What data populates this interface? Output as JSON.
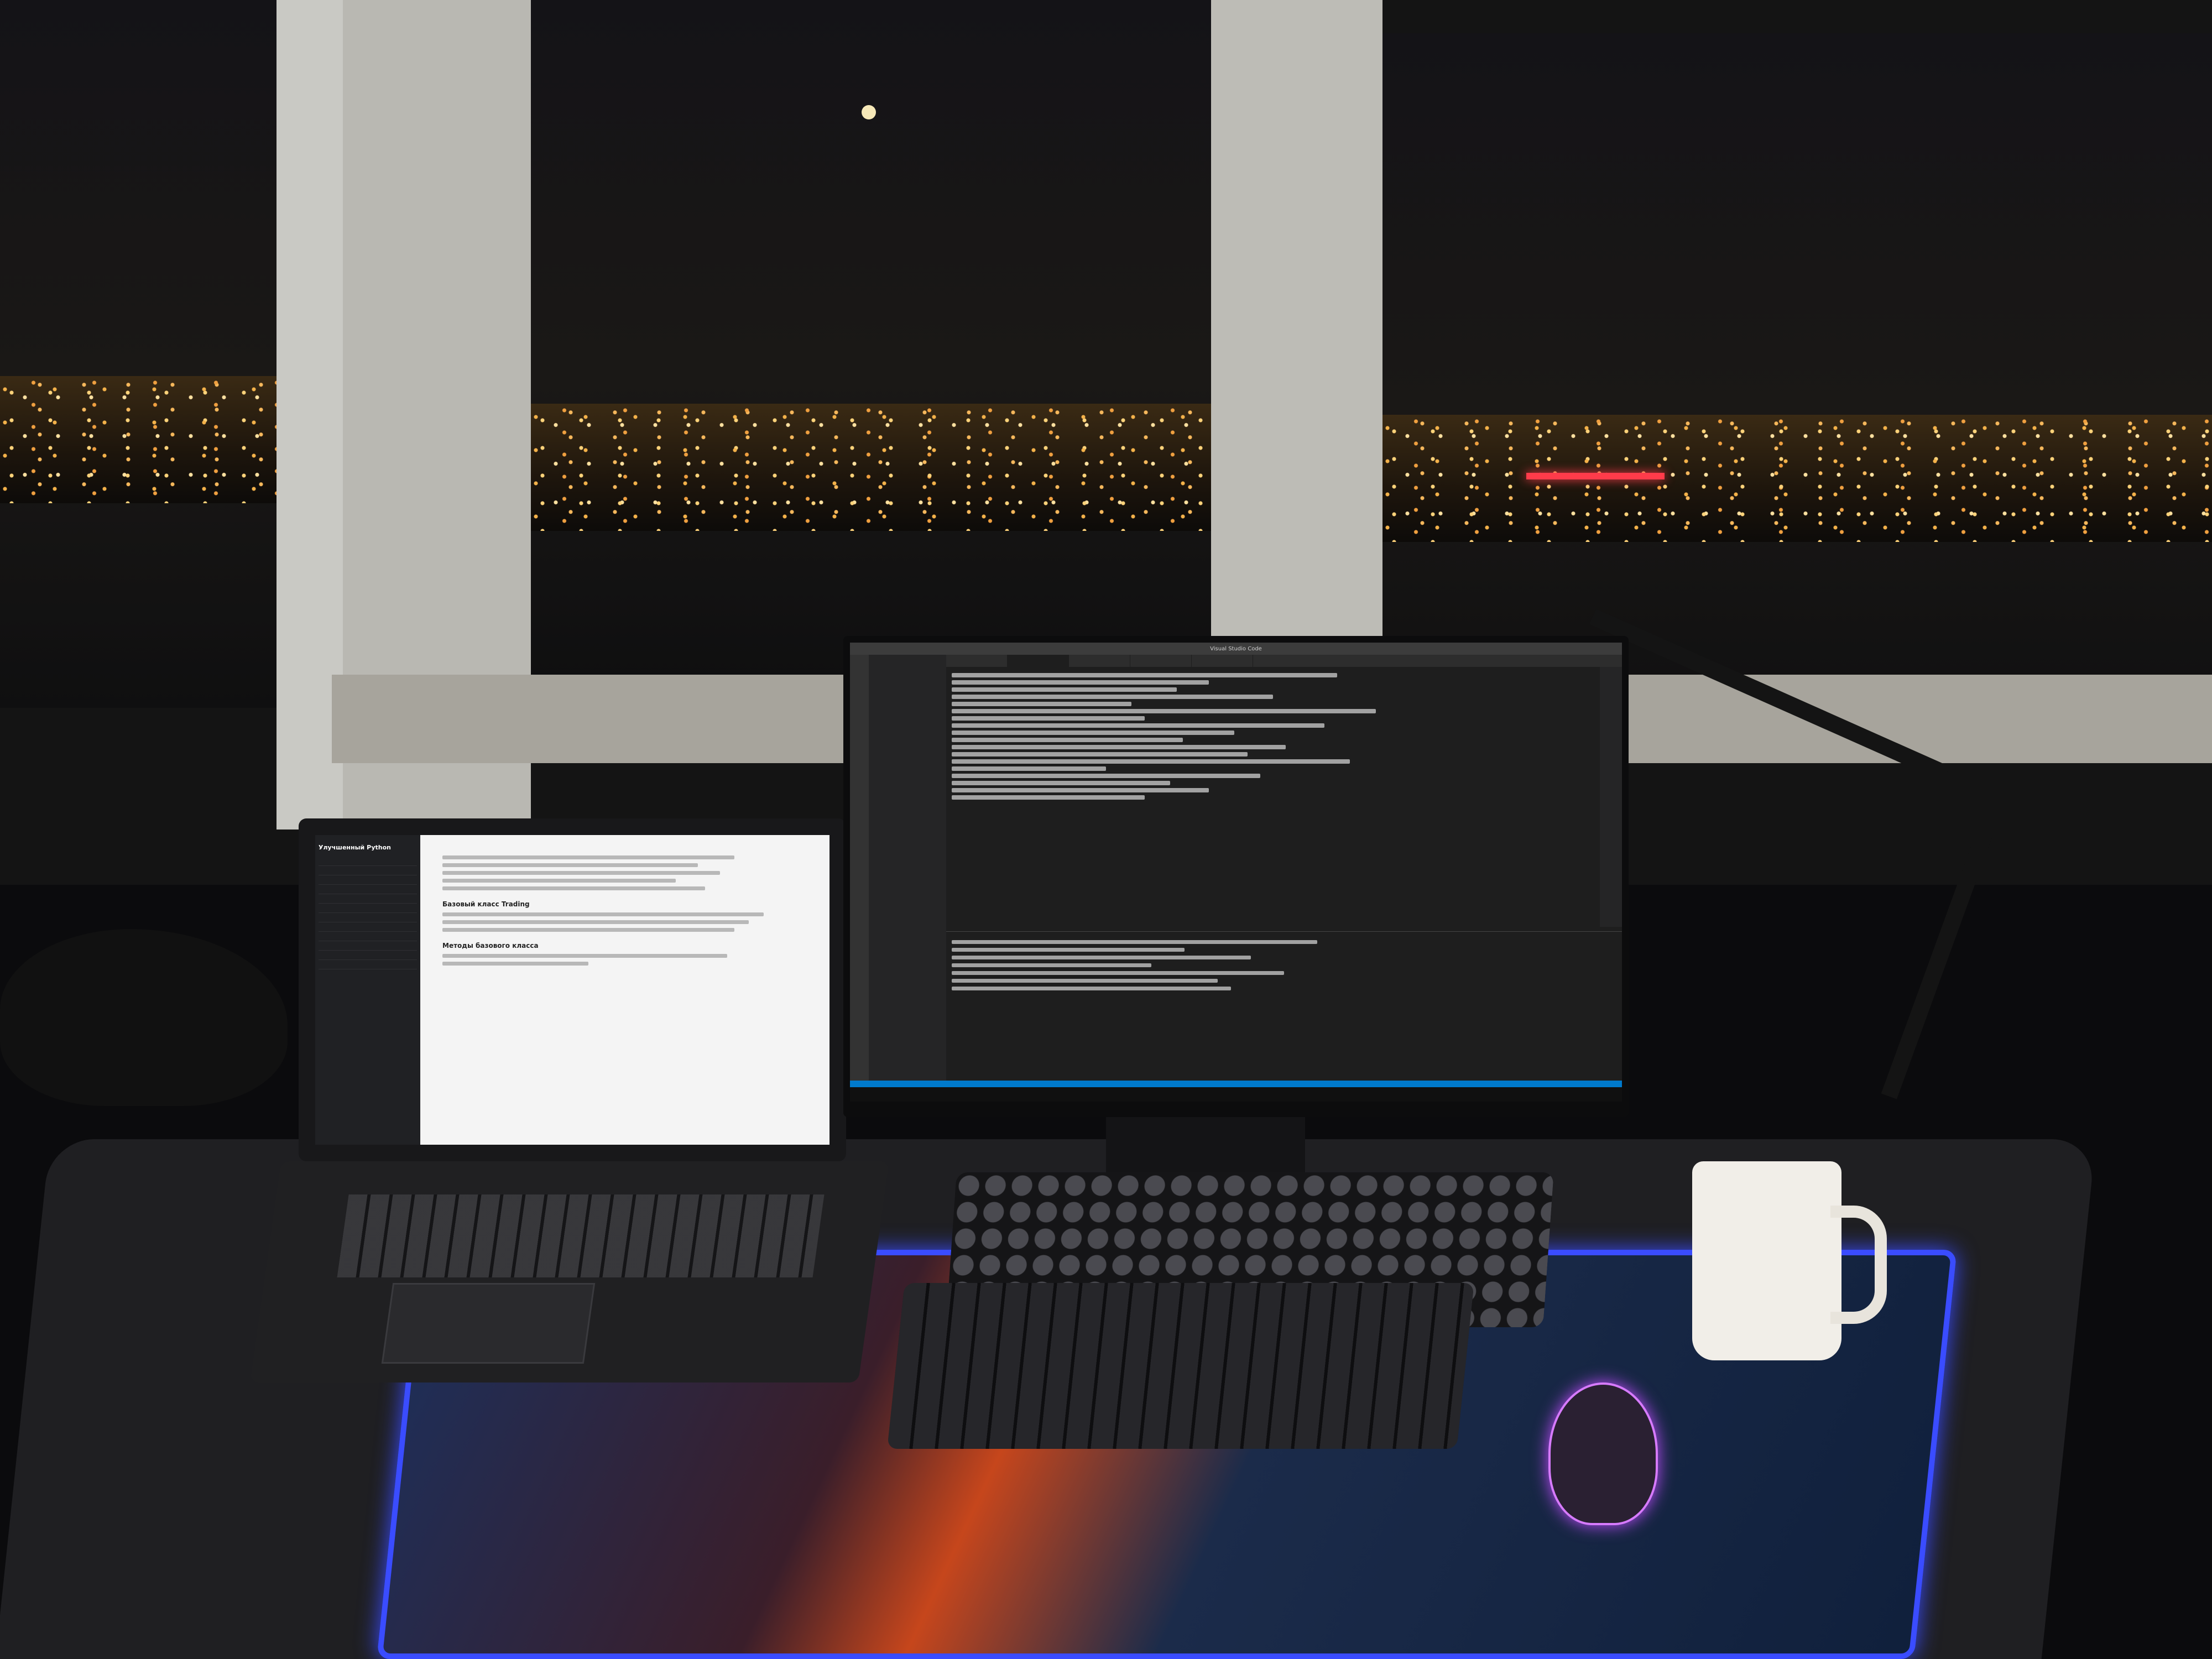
{
  "scene": {
    "description_visible_text": "",
    "colors": {
      "mousepad_glow": "#3a4cff",
      "mouse_glow": "#c04cff",
      "city_lights": "#f4b24a",
      "bridge_light": "#ff3b4a",
      "vscode_statusbar": "#007acc"
    }
  },
  "laptop": {
    "sidebar_title": "Улучшенный Python",
    "section_heading": "Базовый класс Trading",
    "subheading": "Методы базового класса"
  },
  "monitor": {
    "window_title": "Visual Studio Code"
  },
  "icons": [
    "moon",
    "laptop",
    "monitor",
    "keyboard",
    "mouse",
    "mug",
    "desk-lamp"
  ]
}
